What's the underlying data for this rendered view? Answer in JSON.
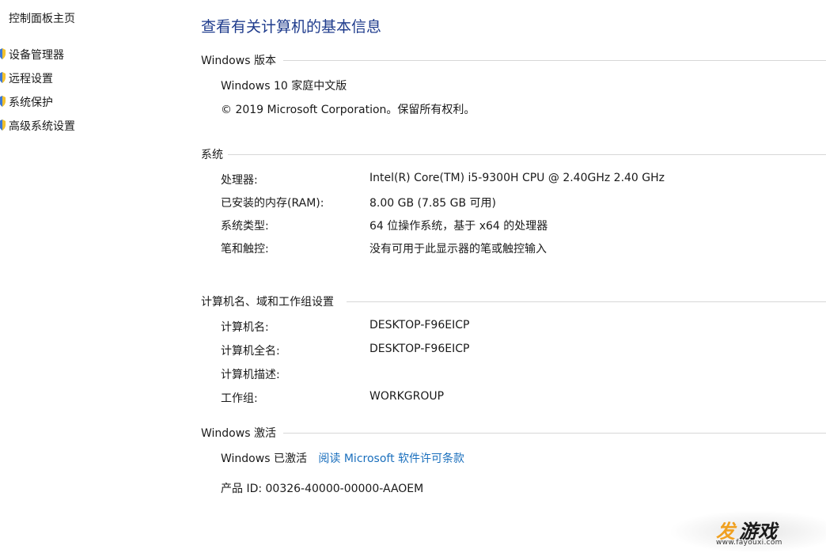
{
  "sidebar": {
    "home": "控制面板主页",
    "items": [
      {
        "label": "设备管理器",
        "icon": "shield-icon"
      },
      {
        "label": "远程设置",
        "icon": "shield-icon"
      },
      {
        "label": "系统保护",
        "icon": "shield-icon"
      },
      {
        "label": "高级系统设置",
        "icon": "shield-icon"
      }
    ]
  },
  "main": {
    "title": "查看有关计算机的基本信息",
    "edition": {
      "heading": "Windows 版本",
      "name": "Windows 10 家庭中文版",
      "copyright": "© 2019 Microsoft Corporation。保留所有权利。"
    },
    "system": {
      "heading": "系统",
      "rows": [
        {
          "label": "处理器:",
          "value": "Intel(R) Core(TM) i5-9300H CPU @ 2.40GHz   2.40 GHz"
        },
        {
          "label": "已安装的内存(RAM):",
          "value": "8.00 GB (7.85 GB 可用)"
        },
        {
          "label": "系统类型:",
          "value": "64 位操作系统，基于 x64 的处理器"
        },
        {
          "label": "笔和触控:",
          "value": "没有可用于此显示器的笔或触控输入"
        }
      ]
    },
    "computer": {
      "heading": "计算机名、域和工作组设置",
      "rows": [
        {
          "label": "计算机名:",
          "value": "DESKTOP-F96EICP"
        },
        {
          "label": "计算机全名:",
          "value": "DESKTOP-F96EICP"
        },
        {
          "label": "计算机描述:",
          "value": ""
        },
        {
          "label": "工作组:",
          "value": "WORKGROUP"
        }
      ]
    },
    "activation": {
      "heading": "Windows 激活",
      "status": "Windows 已激活",
      "link": "阅读 Microsoft 软件许可条款",
      "product_id": "产品 ID: 00326-40000-00000-AAOEM"
    }
  },
  "watermark": {
    "char1": "发",
    "rest": "游戏",
    "url": "www.fayouxi.com"
  },
  "colors": {
    "title": "#1e3b8c",
    "link": "#1a6fbd",
    "rule": "#d7d7d7",
    "watermark_accent": "#f0a020"
  }
}
